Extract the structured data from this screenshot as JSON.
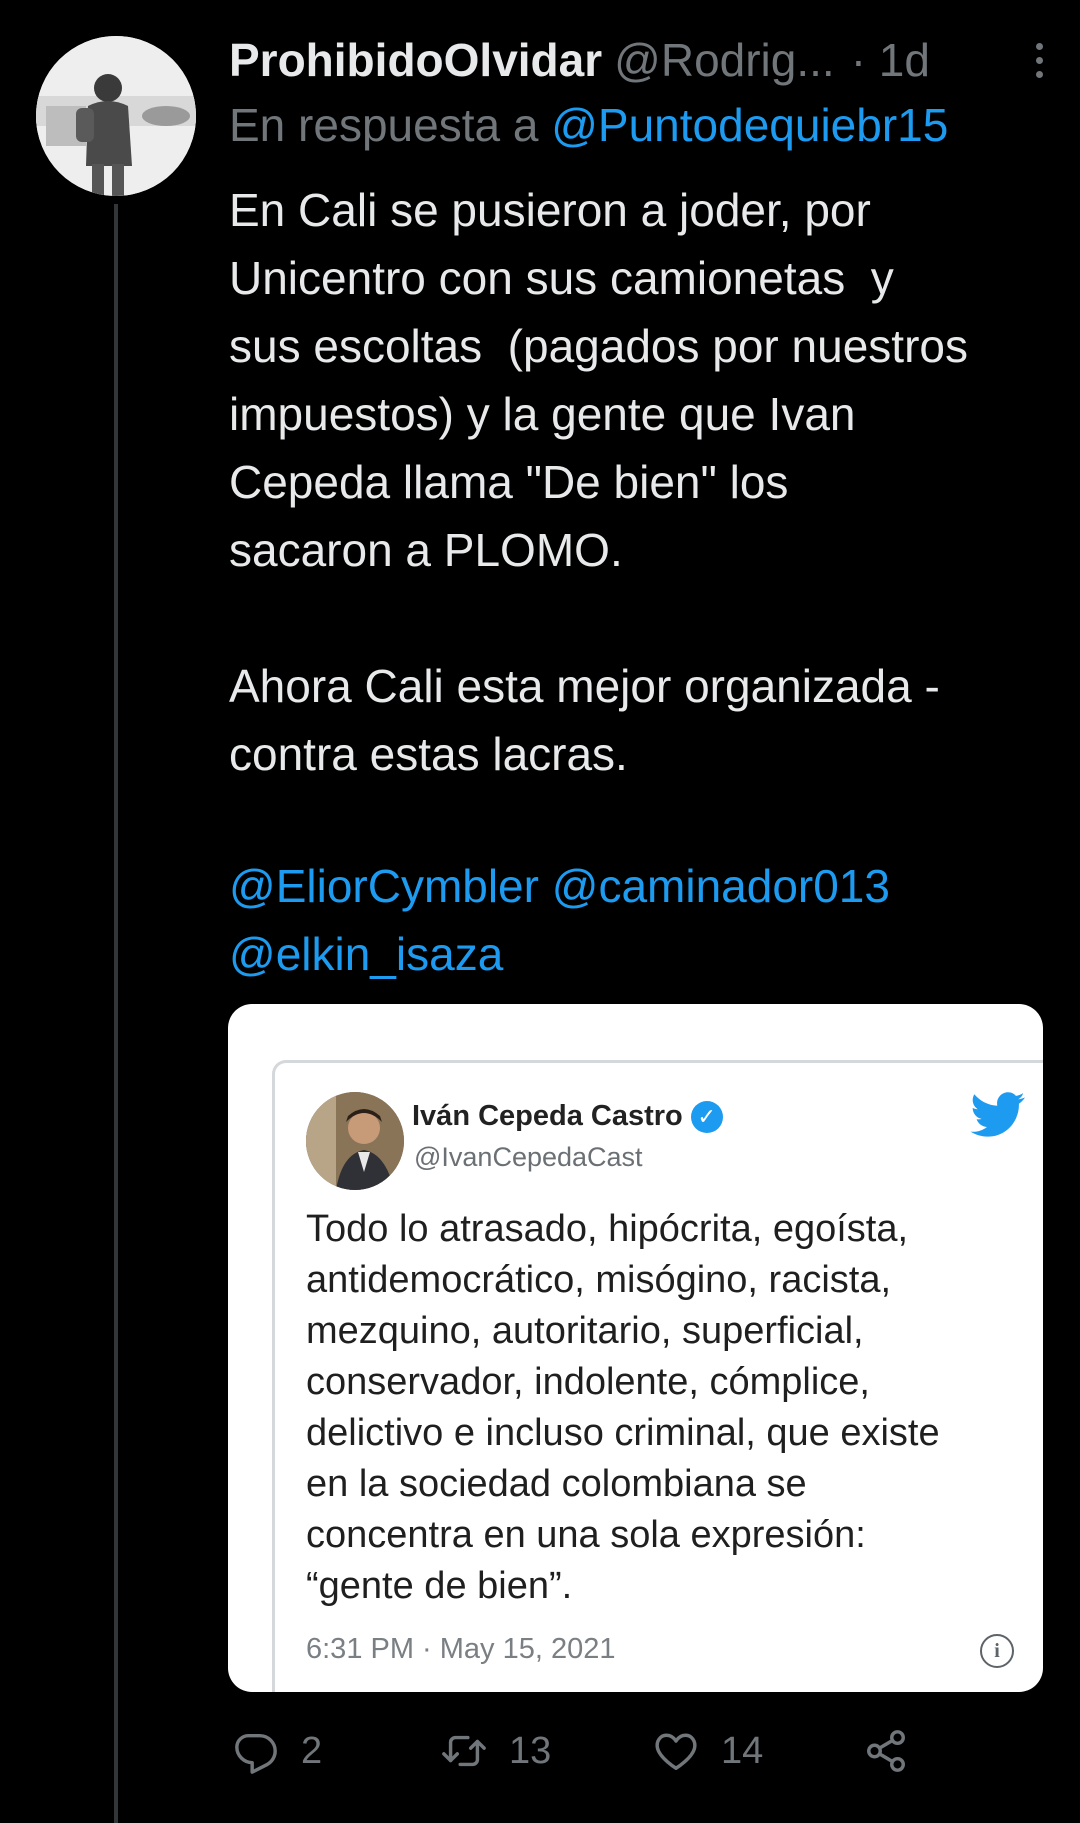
{
  "tweet": {
    "display_name": "ProhibidoOlvidar",
    "handle": "@Rodrig...",
    "time": "· 1d",
    "reply_prefix": "En respuesta a",
    "reply_to": "@Puntodequiebr15",
    "text": "En Cali se pusieron a joder, por\nUnicentro con sus camionetas  y\nsus escoltas  (pagados por nuestros\nimpuestos) y la gente que Ivan\nCepeda llama \"De bien\" los\nsacaron a PLOMO.\n\nAhora Cali esta mejor organizada -\ncontra estas lacras.",
    "mentions": [
      "@EliorCymbler",
      "@caminador013",
      "@elkin_isaza"
    ]
  },
  "embedded_image": {
    "name": "Iván Cepeda Castro",
    "handle": "@IvanCepedaCast",
    "text": "Todo lo atrasado, hipócrita, egoísta,\nantidemocrático, misógino, racista,\nmezquino, autoritario, superficial,\nconservador, indolente, cómplice,\ndelictivo e incluso criminal, que existe\nen la sociedad colombiana se\nconcentra en una sola expresión:\n“gente de bien”.",
    "date": "6:31 PM · May 15, 2021"
  },
  "actions": {
    "replies": "2",
    "retweets": "13",
    "likes": "14"
  },
  "icons": [
    "more-icon",
    "verified-badge-icon",
    "twitter-bird-icon",
    "info-icon",
    "reply-icon",
    "retweet-icon",
    "like-icon",
    "share-icon"
  ],
  "colors": {
    "background": "#000000",
    "text": "#e7e9ea",
    "secondary": "#71767b",
    "link": "#1d9bf0"
  }
}
